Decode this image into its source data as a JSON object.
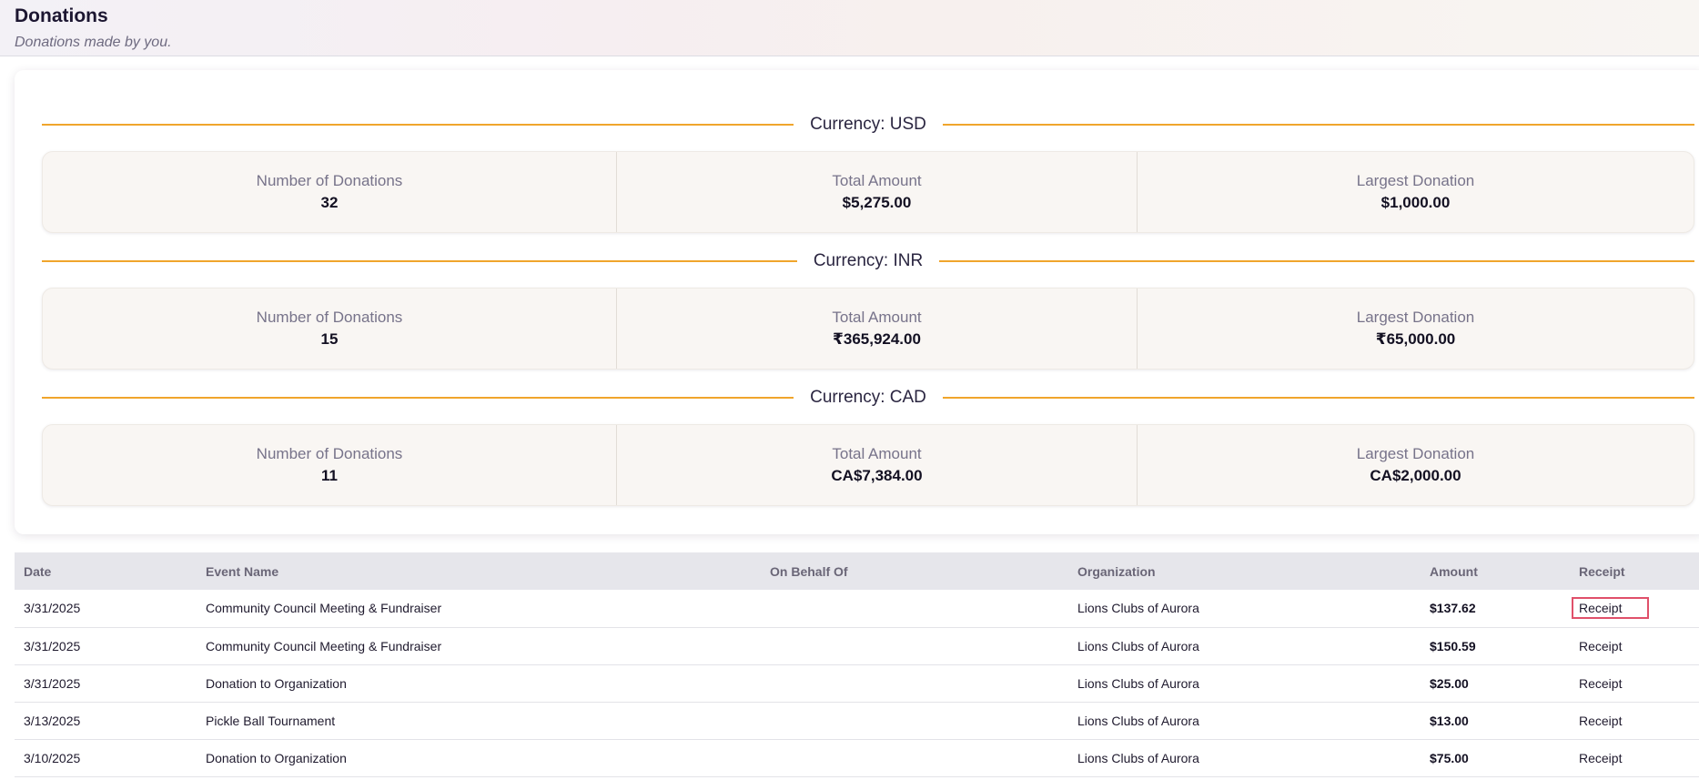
{
  "header": {
    "title": "Donations",
    "subtitle": "Donations made by you."
  },
  "summary": {
    "stat_labels": {
      "count": "Number of Donations",
      "total": "Total Amount",
      "largest": "Largest Donation"
    },
    "currencies": [
      {
        "label": "Currency: USD",
        "count": "32",
        "total": "$5,275.00",
        "largest": "$1,000.00"
      },
      {
        "label": "Currency: INR",
        "count": "15",
        "total": "₹365,924.00",
        "largest": "₹65,000.00"
      },
      {
        "label": "Currency: CAD",
        "count": "11",
        "total": "CA$7,384.00",
        "largest": "CA$2,000.00"
      }
    ]
  },
  "table": {
    "columns": [
      "Date",
      "Event Name",
      "On Behalf Of",
      "Organization",
      "Amount",
      "Receipt"
    ],
    "rows": [
      {
        "date": "3/31/2025",
        "event": "Community Council Meeting & Fundraiser",
        "behalf": "",
        "org": "Lions Clubs of Aurora",
        "amount": "$137.62",
        "receipt": "Receipt"
      },
      {
        "date": "3/31/2025",
        "event": "Community Council Meeting & Fundraiser",
        "behalf": "",
        "org": "Lions Clubs of Aurora",
        "amount": "$150.59",
        "receipt": "Receipt"
      },
      {
        "date": "3/31/2025",
        "event": "Donation to Organization",
        "behalf": "",
        "org": "Lions Clubs of Aurora",
        "amount": "$25.00",
        "receipt": "Receipt"
      },
      {
        "date": "3/13/2025",
        "event": "Pickle Ball Tournament",
        "behalf": "",
        "org": "Lions Clubs of Aurora",
        "amount": "$13.00",
        "receipt": "Receipt"
      },
      {
        "date": "3/10/2025",
        "event": "Donation to Organization",
        "behalf": "",
        "org": "Lions Clubs of Aurora",
        "amount": "$75.00",
        "receipt": "Receipt"
      }
    ]
  },
  "colors": {
    "accent_divider": "#f0a52c",
    "focus_outline": "#e0506a"
  }
}
